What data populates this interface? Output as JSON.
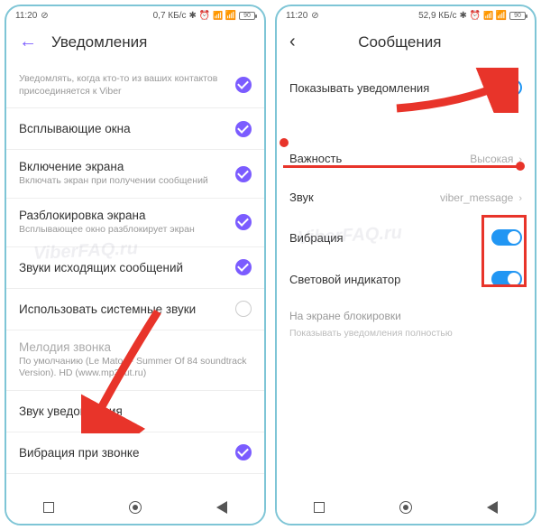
{
  "left": {
    "status": {
      "time": "11:20",
      "data": "0,7 КБ/с",
      "batt": "90"
    },
    "title": "Уведомления",
    "rows": {
      "joined_sub": "Уведомлять, когда кто-то из ваших контактов присоединяется к Viber",
      "popup": "Всплывающие окна",
      "screen_on": "Включение экрана",
      "screen_on_sub": "Включать экран при получении сообщений",
      "unlock": "Разблокировка экрана",
      "unlock_sub": "Всплывающее окно разблокирует экран",
      "outgoing_sounds": "Звуки исходящих сообщений",
      "use_system": "Использовать системные звуки",
      "ringtone": "Мелодия звонка",
      "ringtone_sub": "По умолчанию (Le Matos - Summer Of 84 soundtrack Version). HD (www.mp3cut.ru)",
      "notif_sound": "Звук уведомления",
      "vibrate_call": "Вибрация при звонке"
    }
  },
  "right": {
    "status": {
      "time": "11:20",
      "data": "52,9 КБ/с",
      "batt": "90"
    },
    "title": "Сообщения",
    "rows": {
      "show_notif": "Показывать уведомления",
      "importance": "Важность",
      "importance_val": "Высокая",
      "sound": "Звук",
      "sound_val": "viber_message",
      "vibration": "Вибрация",
      "light": "Световой индикатор",
      "lock_title": "На экране блокировки",
      "lock_sub": "Показывать уведомления полностью"
    }
  },
  "watermark": "ViberFAQ.ru"
}
